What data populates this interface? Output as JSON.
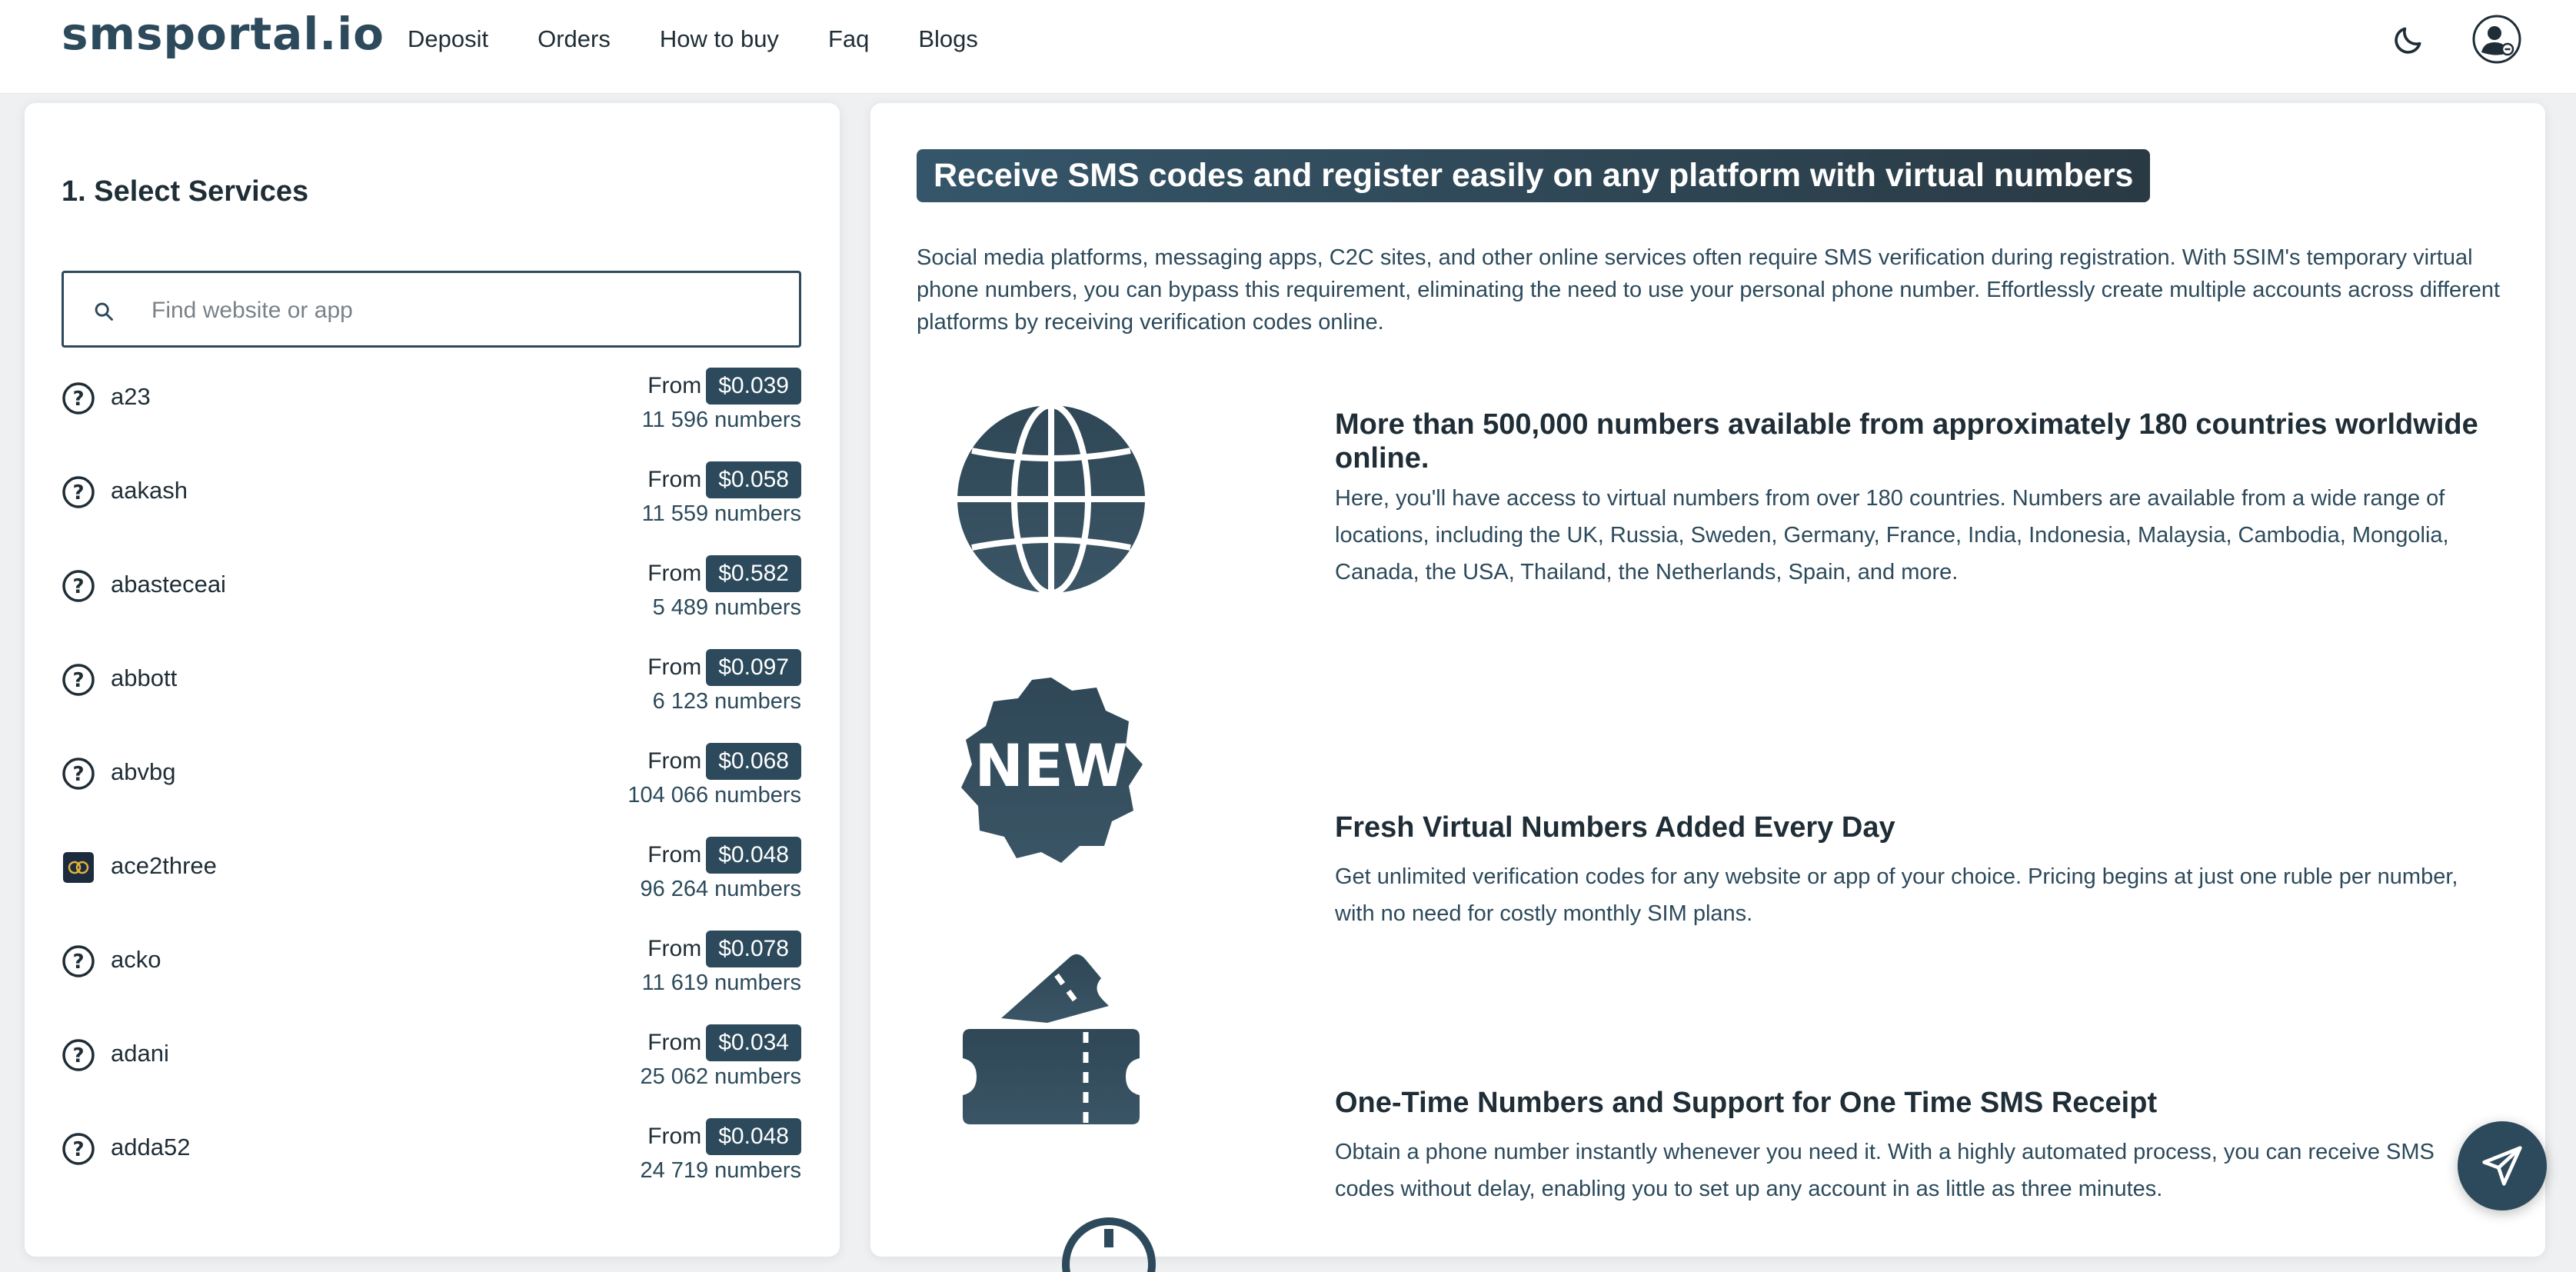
{
  "header": {
    "logo": "smsportal.io",
    "nav": [
      "Deposit",
      "Orders",
      "How to buy",
      "Faq",
      "Blogs"
    ],
    "icons": [
      "moon-icon",
      "user-icon"
    ]
  },
  "services_panel": {
    "title": "1. Select Services",
    "search_placeholder": "Find website or app",
    "from_label": "From",
    "numbers_label": "numbers",
    "items": [
      {
        "name": "a23",
        "price": "$0.039",
        "count": "11 596",
        "icon": "question-icon"
      },
      {
        "name": "aakash",
        "price": "$0.058",
        "count": "11 559",
        "icon": "question-icon"
      },
      {
        "name": "abasteceai",
        "price": "$0.582",
        "count": "5 489",
        "icon": "question-icon"
      },
      {
        "name": "abbott",
        "price": "$0.097",
        "count": "6 123",
        "icon": "question-icon"
      },
      {
        "name": "abvbg",
        "price": "$0.068",
        "count": "104 066",
        "icon": "question-icon"
      },
      {
        "name": "ace2three",
        "price": "$0.048",
        "count": "96 264",
        "icon": "ace2three-logo"
      },
      {
        "name": "acko",
        "price": "$0.078",
        "count": "11 619",
        "icon": "question-icon"
      },
      {
        "name": "adani",
        "price": "$0.034",
        "count": "25 062",
        "icon": "question-icon"
      },
      {
        "name": "adda52",
        "price": "$0.048",
        "count": "24 719",
        "icon": "question-icon"
      }
    ]
  },
  "info_panel": {
    "hero_title": "Receive SMS codes and register easily on any platform with virtual numbers",
    "hero_desc": "Social media platforms, messaging apps, C2C sites, and other online services often require SMS verification during registration. With 5SIM's temporary virtual phone numbers, you can bypass this requirement, eliminating the need to use your personal phone number. Effortlessly create multiple accounts across different platforms by receiving verification codes online.",
    "features": [
      {
        "icon": "globe-icon",
        "title": "More than 500,000 numbers available from approximately 180 countries worldwide online.",
        "text": "Here, you'll have access to virtual numbers from over 180 countries. Numbers are available from a wide range of locations, including the UK, Russia, Sweden, Germany, France, India, Indonesia, Malaysia, Cambodia, Mongolia, Canada, the USA, Thailand, the Netherlands, Spain, and more."
      },
      {
        "icon": "new-badge-icon",
        "badge_text": "NEW",
        "title": "Fresh Virtual Numbers Added Every Day",
        "text": "Get unlimited verification codes for any website or app of your choice. Pricing begins at just one ruble per number, with no need for costly monthly SIM plans."
      },
      {
        "icon": "ticket-icon",
        "title": "One-Time Numbers and Support for One Time SMS Receipt",
        "text": "Obtain a phone number instantly whenever you need it. With a highly automated process, you can receive SMS codes without delay, enabling you to set up any account in as little as three minutes."
      }
    ]
  },
  "colors": {
    "accent": "#2c4a5b",
    "text": "#1f2d36",
    "background": "#eef0f2"
  }
}
